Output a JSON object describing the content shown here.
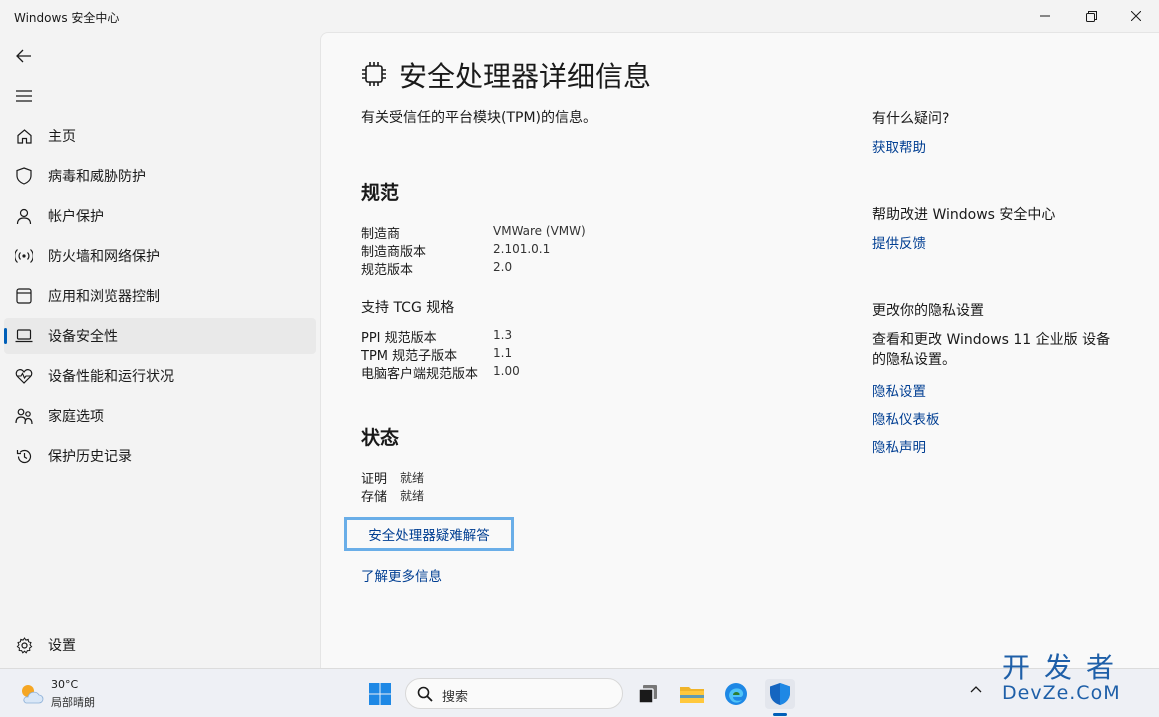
{
  "window": {
    "title": "Windows 安全中心"
  },
  "sidebar": {
    "items": [
      {
        "label": "主页"
      },
      {
        "label": "病毒和威胁防护"
      },
      {
        "label": "帐户保护"
      },
      {
        "label": "防火墙和网络保护"
      },
      {
        "label": "应用和浏览器控制"
      },
      {
        "label": "设备安全性"
      },
      {
        "label": "设备性能和运行状况"
      },
      {
        "label": "家庭选项"
      },
      {
        "label": "保护历史记录"
      }
    ],
    "selected": "设备安全性",
    "settings_label": "设置"
  },
  "main": {
    "title": "安全处理器详细信息",
    "description": "有关受信任的平台模块(TPM)的信息。",
    "spec": {
      "heading": "规范",
      "rows": [
        {
          "key": "制造商",
          "value": "VMWare (VMW)"
        },
        {
          "key": "制造商版本",
          "value": "2.101.0.1"
        },
        {
          "key": "规范版本",
          "value": "2.0"
        }
      ],
      "tcg_heading": "支持 TCG 规格",
      "tcg_rows": [
        {
          "key": "PPI 规范版本",
          "value": "1.3"
        },
        {
          "key": "TPM 规范子版本",
          "value": "1.1"
        },
        {
          "key": "电脑客户端规范版本",
          "value": "1.00"
        }
      ]
    },
    "status": {
      "heading": "状态",
      "rows": [
        {
          "key": "证明",
          "value": "就绪"
        },
        {
          "key": "存储",
          "value": "就绪"
        }
      ]
    },
    "troubleshoot_label": "安全处理器疑难解答",
    "learn_more_label": "了解更多信息"
  },
  "right": {
    "help_heading": "有什么疑问?",
    "help_link": "获取帮助",
    "improve_heading": "帮助改进 Windows 安全中心",
    "feedback_link": "提供反馈",
    "privacy_heading": "更改你的隐私设置",
    "privacy_text": "查看和更改 Windows 11 企业版 设备的隐私设置。",
    "privacy_links": [
      "隐私设置",
      "隐私仪表板",
      "隐私声明"
    ]
  },
  "taskbar": {
    "weather_temp": "30°C",
    "weather_desc": "局部晴朗",
    "search_placeholder": "搜索"
  },
  "watermark": {
    "line1": "开发者",
    "line2": "DevZe.CoM"
  },
  "colors": {
    "accent": "#005fb8",
    "link": "#003e92",
    "highlight_border": "#6aaee8"
  }
}
